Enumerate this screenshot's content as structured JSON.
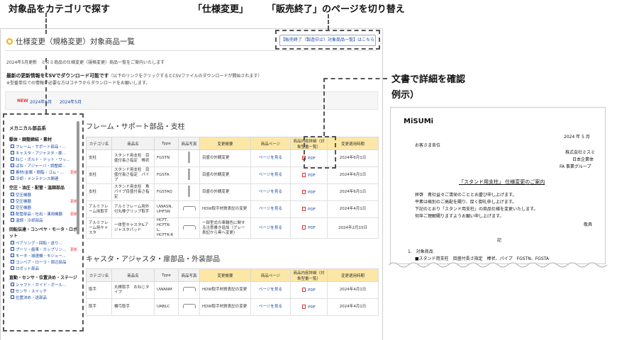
{
  "annotations": {
    "category": "対象品をカテゴリで探す",
    "switch_a": "「仕様変更」",
    "switch_b": "「販売終了」のページを切り替え",
    "doc_line1": "文書で詳細を確認",
    "doc_line2": "例示）"
  },
  "header": {
    "title": "仕様変更（規格変更）対象商品一覧",
    "switch_button": "【販売終了（製造中止）対象商品一覧】はこちら"
  },
  "intro": {
    "line1": "2024年5月更新　ミスミ商品の仕様変更（規格変更）商品一覧をご案内いたします",
    "csv_bold": "最新の更新情報をCSVでダウンロード可能です",
    "csv_rest": "（以下のリンクをクリックするとCSVファイルのダウンロードが開始されます）",
    "note": "※型番単位での情報が必要な方はコチラからダウンロードをお願いします。"
  },
  "datebar": {
    "new": "NEW",
    "d1": "2024年6月",
    "d2": "2024年5月"
  },
  "sidebar": {
    "head": "メカニカル部品系",
    "sections": [
      {
        "title": "駆体・調整締結・素材",
        "items": [
          {
            "label": "フレーム・サポート部品・...",
            "upd": ""
          },
          {
            "label": "キャスタ・アジャスタ・扉...",
            "upd": ""
          },
          {
            "label": "ねじ・ボルト・ナット・ワッ...",
            "upd": ""
          },
          {
            "label": "ばね・アジャーバ・調整締...",
            "upd": ""
          },
          {
            "label": "素材(金属・樹脂・ゴム・...",
            "upd": "更新"
          },
          {
            "label": "冷却・メンテナンス関連",
            "upd": ""
          }
        ]
      },
      {
        "title": "空圧・油圧・配管・温調部品",
        "items": [
          {
            "label": "空圧機器",
            "upd": ""
          },
          {
            "label": "空圧機器",
            "upd": "更新"
          },
          {
            "label": "空圧機器",
            "upd": ""
          },
          {
            "label": "配管部品・吐出・凍用機器",
            "upd": "更新"
          },
          {
            "label": "温調・冷却部品",
            "upd": ""
          }
        ]
      },
      {
        "title": "回転伝達・コンベヤ・モータ・ロボット",
        "items": [
          {
            "label": "ベアリング・回転・送り...",
            "upd": ""
          },
          {
            "label": "プーリ・歯車・カップリン...",
            "upd": "更新"
          },
          {
            "label": "モータ・減速機・モジュー...",
            "upd": ""
          },
          {
            "label": "コンベア・ローラ・周辺部品",
            "upd": ""
          },
          {
            "label": "ロボット部品",
            "upd": ""
          }
        ]
      },
      {
        "title": "直動・センサ・位置決め・ステージ",
        "items": [
          {
            "label": "シャフト・ガイド・ボール...",
            "upd": ""
          },
          {
            "label": "センサ・スイッチ",
            "upd": ""
          },
          {
            "label": "位置決め・送部品",
            "upd": ""
          }
        ]
      }
    ]
  },
  "table_headers": [
    "カテゴリ名",
    "商品名",
    "Type",
    "商品写真",
    "変更概要",
    "商品ページ",
    "商品内容詳細（対象型番一覧）",
    "変更適用時期"
  ],
  "section1": {
    "title": "フレーム・サポート部品・支柱",
    "rows": [
      {
        "cat": "支柱",
        "name": "スタンド用支柱　目盛付長さ指定　棒状",
        "type": "FGSTN",
        "change": "目盛の外観変更",
        "link": "ページを見る",
        "pdf": "PDF",
        "date": "2024年6月1日"
      },
      {
        "cat": "支柱",
        "name": "スタンド用支柱　目盛付長さ指定　パイプ",
        "type": "FGSTA",
        "change": "目盛の外観変更",
        "link": "ページを見る",
        "pdf": "PDF",
        "date": "2024年6月1日"
      },
      {
        "cat": "支柱",
        "name": "スタンド用支柱　角パイプ目盛付長さ指定",
        "type": "FGSTAQ",
        "change": "目盛の外観変更",
        "link": "ページを見る",
        "pdf": "PDF",
        "date": "2024年6月1日"
      },
      {
        "cat": "アルミフレーム用取手",
        "name": "アルミフレーム用外付丸棒グリップ取手",
        "type": "UWASN、UHFSN",
        "change": "HDW取手材質表記の変更",
        "link": "ページを見る",
        "pdf": "PDF",
        "date": "2024年4月1日"
      },
      {
        "cat": "アルミフレーム用キャスタ",
        "name": "一体型キャスタ&アジャスタパッド",
        "type": "HCFT、HCFTK-L、HCFTK-R",
        "change": "一部型式の車輪色に関する注意書き追加（グレー表記から黒へ変更）",
        "link": "ページを見る",
        "pdf": "PDF",
        "date": "2024年2月15日"
      }
    ]
  },
  "section2": {
    "title": "キャスタ・アジャスタ・扉部品・外装部品",
    "rows": [
      {
        "cat": "取手",
        "name": "丸棒取手　おねじタイプ",
        "type": "UWANM",
        "change": "HDW取手材質表記の変更",
        "link": "ページを見る",
        "pdf": "PDF",
        "date": "2024年4月1日"
      },
      {
        "cat": "取手",
        "name": "橋弓取手",
        "type": "UABLC",
        "change": "HDW取手材質表記の変更",
        "link": "ページを見る",
        "pdf": "PDF",
        "date": "2024年4月1日"
      }
    ]
  },
  "doc": {
    "logo": "MiSUMi",
    "date": "2024 年 5 月",
    "to": "お客さま各位",
    "from1": "株式会社ミスミ",
    "from2": "日本企業体",
    "from3": "FA 事業グループ",
    "title": "「スタンド用支柱」 仕様変更のご案内",
    "p1": "拝啓　貴社益々ご清栄のこととお慶び申し上げます。",
    "p2": "平素は格別のご高配を賜り、厚く御礼申し上げます。",
    "p3": "下記のとおり「スタンド用支柱」の商品仕様を変更いたします。",
    "p4": "何卒ご理解賜りますようお願い申し上げます。",
    "keigu": "敬具",
    "ki": "記",
    "item1": "1.　対象商品",
    "item1a": "■スタンド用支柱　目盛付長さ指定　棒状、パイプ　FGSTN、FGSTA"
  }
}
